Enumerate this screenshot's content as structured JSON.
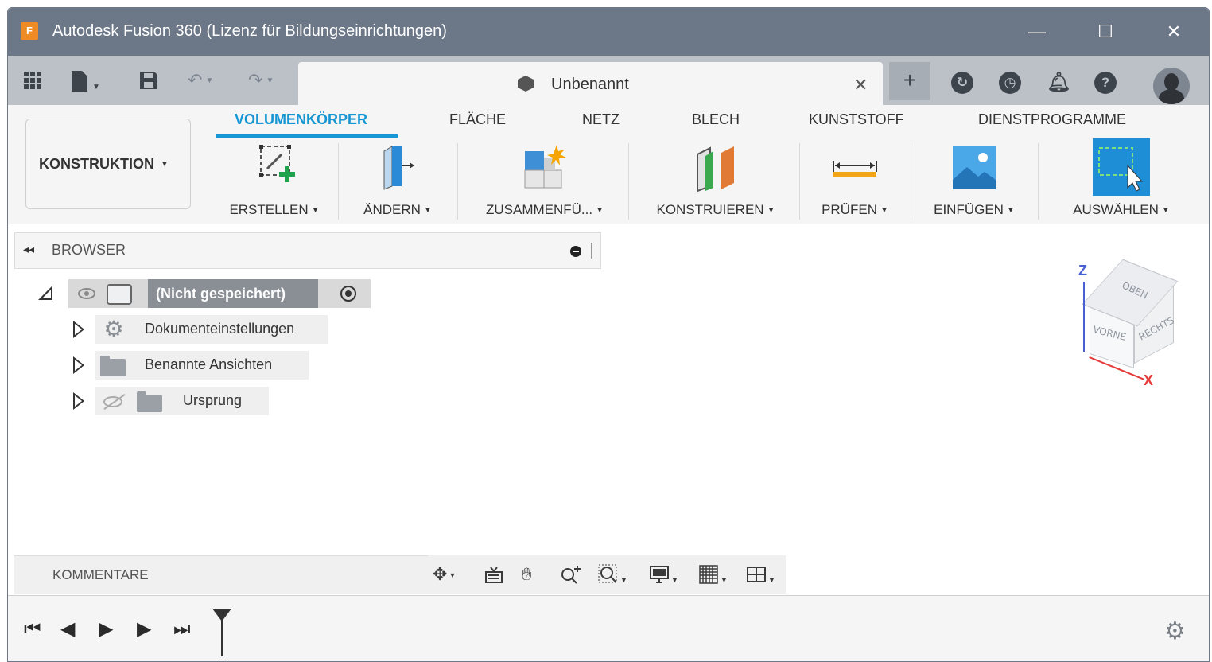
{
  "window": {
    "title": "Autodesk Fusion 360 (Lizenz für Bildungseinrichtungen)",
    "app_logo_letter": "F",
    "controls": {
      "minimize": "—",
      "maximize": "☐",
      "close": "✕"
    }
  },
  "quick_access": {
    "icons": [
      "grid-icon",
      "file-icon",
      "save-icon",
      "undo-icon",
      "redo-icon"
    ],
    "document_tab": {
      "title": "Unbenannt",
      "close": "✕"
    },
    "new_tab": "+",
    "right_icons": [
      "sync-icon",
      "history-icon",
      "notification-icon",
      "help-icon",
      "avatar"
    ]
  },
  "ribbon": {
    "workspace": "KONSTRUKTION",
    "tabs": [
      {
        "label": "VOLUMENKÖRPER",
        "active": true
      },
      {
        "label": "FLÄCHE",
        "active": false
      },
      {
        "label": "NETZ",
        "active": false
      },
      {
        "label": "BLECH",
        "active": false
      },
      {
        "label": "KUNSTSTOFF",
        "active": false
      },
      {
        "label": "DIENSTPROGRAMME",
        "active": false
      }
    ],
    "groups": [
      {
        "label": "ERSTELLEN",
        "icon": "create-sketch-icon"
      },
      {
        "label": "ÄNDERN",
        "icon": "modify-icon"
      },
      {
        "label": "ZUSAMMENFÜ...",
        "icon": "assemble-icon"
      },
      {
        "label": "KONSTRUIEREN",
        "icon": "construct-icon"
      },
      {
        "label": "PRÜFEN",
        "icon": "inspect-icon"
      },
      {
        "label": "EINFÜGEN",
        "icon": "insert-icon"
      },
      {
        "label": "AUSWÄHLEN",
        "icon": "select-icon"
      }
    ],
    "accent": "#1696d2"
  },
  "browser": {
    "title": "BROWSER",
    "root": {
      "label": "(Nicht gespeichert)"
    },
    "items": [
      {
        "label": "Dokumenteinstellungen",
        "icon": "gear-icon"
      },
      {
        "label": "Benannte Ansichten",
        "icon": "folder-icon"
      },
      {
        "label": "Ursprung",
        "icon": "folder-icon",
        "hidden": true
      }
    ]
  },
  "viewcube": {
    "faces": {
      "top": "OBEN",
      "front": "VORNE",
      "right": "RECHTS"
    },
    "axes": {
      "z": "Z",
      "x": "X"
    },
    "colors": {
      "z": "#4a5fd0",
      "x": "#e53a3a"
    }
  },
  "comments": {
    "label": "KOMMENTARE"
  },
  "nav_tools": [
    "orbit-icon",
    "look-at-icon",
    "pan-icon",
    "zoom-icon",
    "fit-icon",
    "display-settings-icon",
    "grid-settings-icon",
    "viewports-icon"
  ],
  "timeline": {
    "buttons": [
      "first-icon",
      "previous-icon",
      "play-icon",
      "next-icon",
      "last-icon"
    ]
  }
}
